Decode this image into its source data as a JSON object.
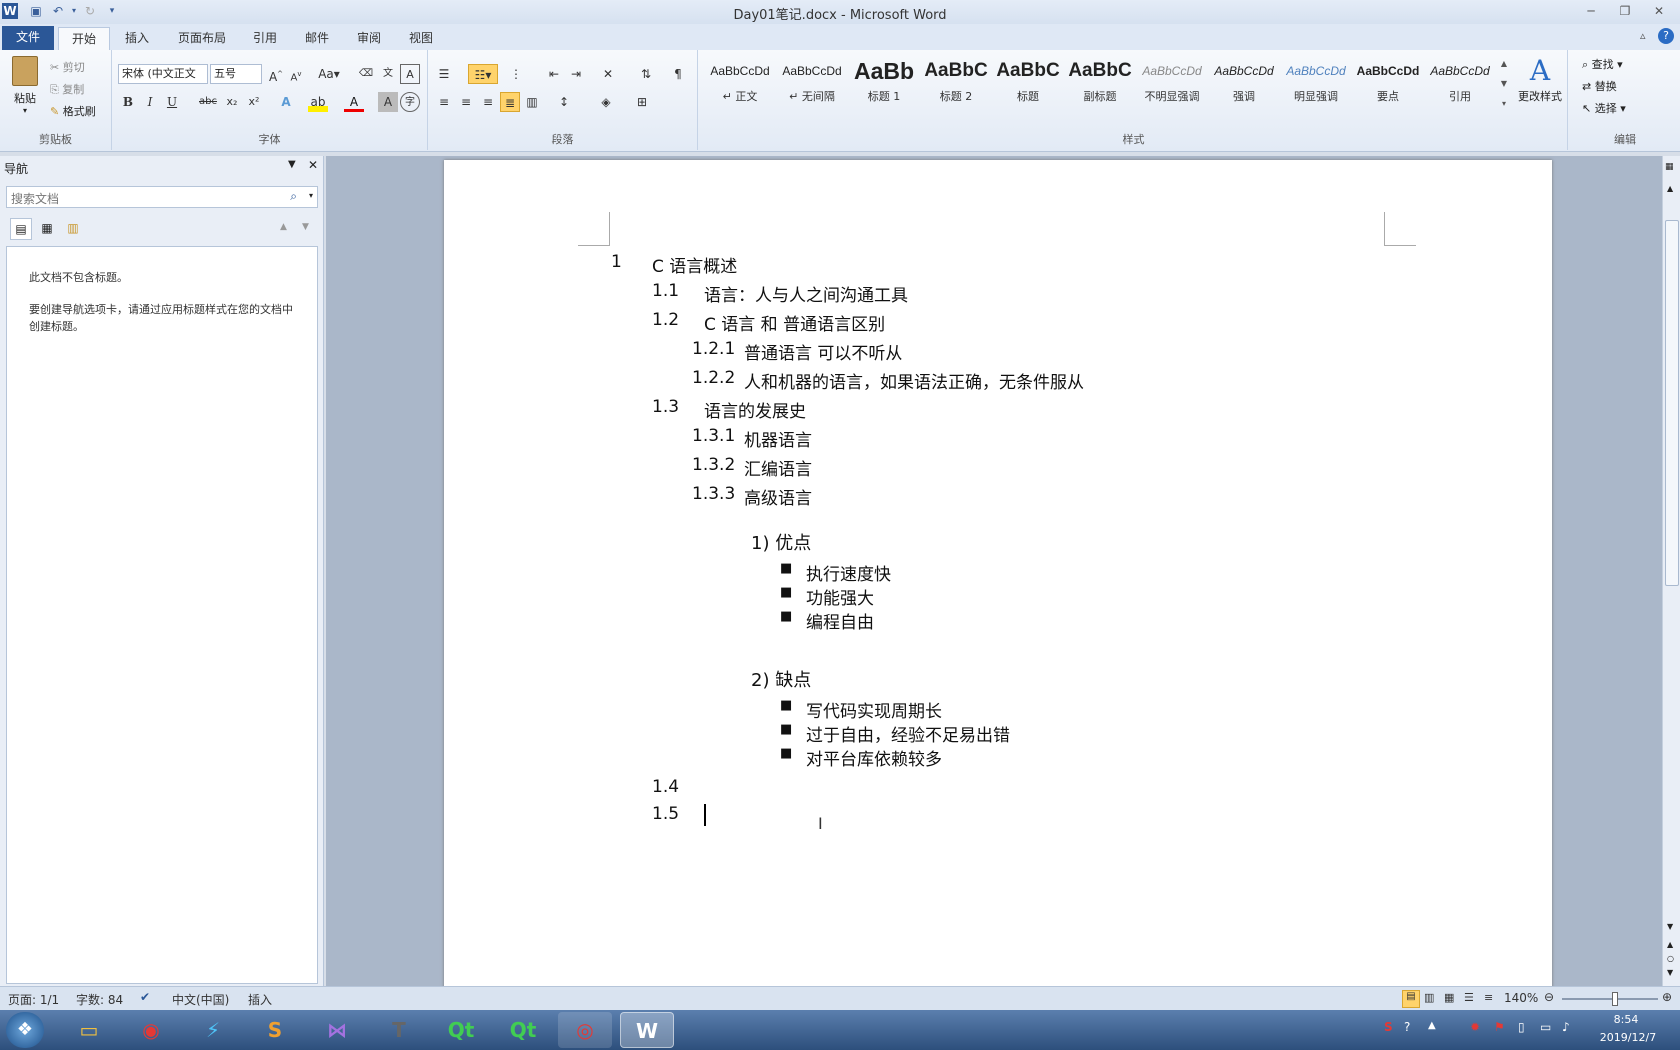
{
  "window": {
    "title": "Day01笔记.docx - Microsoft Word"
  },
  "tabs": [
    "文件",
    "开始",
    "插入",
    "页面布局",
    "引用",
    "邮件",
    "审阅",
    "视图"
  ],
  "clipboard": {
    "paste": "粘贴",
    "cut": "剪切",
    "copy": "复制",
    "format_painter": "格式刷",
    "group": "剪贴板"
  },
  "font": {
    "name": "宋体 (中文正文",
    "size": "五号",
    "group": "字体"
  },
  "paragraph": {
    "group": "段落"
  },
  "styles": {
    "group": "样式",
    "change": "更改样式",
    "items": [
      {
        "preview": "AaBbCcDd",
        "name": "↵ 正文"
      },
      {
        "preview": "AaBbCcDd",
        "name": "↵ 无间隔"
      },
      {
        "preview": "AaBb",
        "name": "标题 1"
      },
      {
        "preview": "AaBbC",
        "name": "标题 2"
      },
      {
        "preview": "AaBbC",
        "name": "标题"
      },
      {
        "preview": "AaBbC",
        "name": "副标题"
      },
      {
        "preview": "AaBbCcDd",
        "name": "不明显强调"
      },
      {
        "preview": "AaBbCcDd",
        "name": "强调"
      },
      {
        "preview": "AaBbCcDd",
        "name": "明显强调"
      },
      {
        "preview": "AaBbCcDd",
        "name": "要点"
      },
      {
        "preview": "AaBbCcDd",
        "name": "引用"
      }
    ]
  },
  "editing": {
    "find": "查找",
    "replace": "替换",
    "select": "选择",
    "group": "编辑"
  },
  "nav": {
    "title": "导航",
    "search_placeholder": "搜索文档",
    "msg1": "此文档不包含标题。",
    "msg2": "要创建导航选项卡，请通过应用标题样式在您的文档中创建标题。"
  },
  "doc": {
    "h1": {
      "num": "1",
      "text": "C 语言概述"
    },
    "h1_1": {
      "num": "1.1",
      "text": "语言：人与人之间沟通工具"
    },
    "h1_2": {
      "num": "1.2",
      "text": "C 语言  和  普通语言区别"
    },
    "h1_2_1": {
      "num": "1.2.1",
      "text": "普通语言  可以不听从"
    },
    "h1_2_2": {
      "num": "1.2.2",
      "text": "人和机器的语言，如果语法正确，无条件服从"
    },
    "h1_3": {
      "num": "1.3",
      "text": "语言的发展史"
    },
    "h1_3_1": {
      "num": "1.3.1",
      "text": "机器语言"
    },
    "h1_3_2": {
      "num": "1.3.2",
      "text": "汇编语言"
    },
    "h1_3_3": {
      "num": "1.3.3",
      "text": "高级语言"
    },
    "pros": {
      "title": "1) 优点",
      "items": [
        "执行速度快",
        "功能强大",
        "编程自由"
      ]
    },
    "cons": {
      "title": "2) 缺点",
      "items": [
        "写代码实现周期长",
        "过于自由，经验不足易出错",
        "对平台库依赖较多"
      ]
    },
    "h1_4": {
      "num": "1.4"
    },
    "h1_5": {
      "num": "1.5"
    }
  },
  "status": {
    "page": "页面: 1/1",
    "words": "字数: 84",
    "lang": "中文(中国)",
    "mode": "插入",
    "zoom": "140%"
  },
  "clock": {
    "time": "8:54",
    "date": "2019/12/7"
  }
}
